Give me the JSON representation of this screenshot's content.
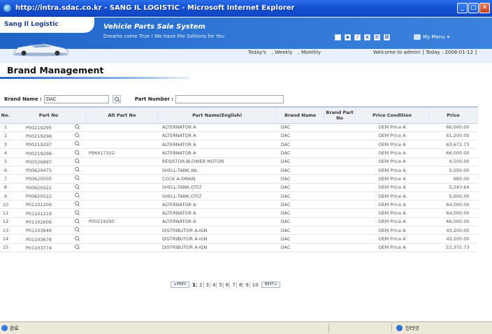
{
  "window": {
    "title": "http://intra.sdac.co.kr - SANG IL LOGISTIC - Microsoft Internet Explorer",
    "min": "_",
    "max": "□",
    "close": "✕"
  },
  "header": {
    "brand": "Sang Il Logistic",
    "system_title": "Vehicle Parts Sale System",
    "tagline": "Dreams come True ! We have the Soltions for You",
    "my_menu": "My Menu",
    "nav": [
      "Today's",
      ", Weekly",
      ", Monthly"
    ],
    "welcome": "Welcome to admin! [ Today : 2006-01-12 ]"
  },
  "page": {
    "title": "Brand Management"
  },
  "search": {
    "brand_label": "Brand Name :",
    "brand_value": "DAC",
    "part_label": "Part Number :",
    "part_value": ""
  },
  "table": {
    "headers": [
      "No.",
      "Part No",
      "Alt Part No",
      "Part Name(English)",
      "Brand Name",
      "Brand Part No",
      "Price Condition",
      "Price"
    ],
    "rows": [
      {
        "no": "1",
        "part": "P00219295",
        "alt": "",
        "name": "ALTERNATOR A",
        "brand": "DAC",
        "bpn": "",
        "cond": "OEM Price A",
        "price": "66,000.00"
      },
      {
        "no": "2",
        "part": "P00219296",
        "alt": "",
        "name": "ALTERNATOR A",
        "brand": "DAC",
        "bpn": "",
        "cond": "OEM Price A",
        "price": "61,200.00"
      },
      {
        "no": "3",
        "part": "P00219297",
        "alt": "",
        "name": "ALTERNATOR A",
        "brand": "DAC",
        "bpn": "",
        "cond": "OEM Price A",
        "price": "63,672.73"
      },
      {
        "no": "4",
        "part": "P00219298",
        "alt": "P96417322",
        "name": "ALTERNATOR A",
        "brand": "DAC",
        "bpn": "",
        "cond": "OEM Price A",
        "price": "66,000.00"
      },
      {
        "no": "5",
        "part": "P00526897",
        "alt": "",
        "name": "RESISTOR-BLOWER MOTOR",
        "brand": "DAC",
        "bpn": "",
        "cond": "OEM Price A",
        "price": "4,500.00"
      },
      {
        "no": "6",
        "part": "P00620475",
        "alt": "",
        "name": "SHELL-TANK,INL",
        "brand": "DAC",
        "bpn": "",
        "cond": "OEM Price A",
        "price": "5,050.00"
      },
      {
        "no": "7",
        "part": "P00620505",
        "alt": "",
        "name": "COCK A-DRAIN",
        "brand": "DAC",
        "bpn": "",
        "cond": "OEM Price A",
        "price": "680.00"
      },
      {
        "no": "8",
        "part": "P00620521",
        "alt": "",
        "name": "SHELL-TANK,OTLT",
        "brand": "DAC",
        "bpn": "",
        "cond": "OEM Price A",
        "price": "5,243.64"
      },
      {
        "no": "9",
        "part": "P00620522",
        "alt": "",
        "name": "SHELL-TANK,OTLT",
        "brand": "DAC",
        "bpn": "",
        "cond": "OEM Price A",
        "price": "5,600.00"
      },
      {
        "no": "10",
        "part": "P01101206",
        "alt": "",
        "name": "ALTERNATOR A",
        "brand": "DAC",
        "bpn": "",
        "cond": "OEM Price A",
        "price": "64,000.00"
      },
      {
        "no": "11",
        "part": "P01101219",
        "alt": "",
        "name": "ALTERNATOR A",
        "brand": "DAC",
        "bpn": "",
        "cond": "OEM Price A",
        "price": "64,000.00"
      },
      {
        "no": "12",
        "part": "P01102606",
        "alt": "P00219295",
        "name": "ALTERNATOR A",
        "brand": "DAC",
        "bpn": "",
        "cond": "OEM Price A",
        "price": "66,000.00"
      },
      {
        "no": "13",
        "part": "P01103649",
        "alt": "",
        "name": "DISTRIBUTOR A-IGN",
        "brand": "DAC",
        "bpn": "",
        "cond": "OEM Price A",
        "price": "43,200.00"
      },
      {
        "no": "14",
        "part": "P01103678",
        "alt": "",
        "name": "DISTRIBUTOR A-IGN",
        "brand": "DAC",
        "bpn": "",
        "cond": "OEM Price A",
        "price": "43,200.00"
      },
      {
        "no": "15",
        "part": "P01103774",
        "alt": "",
        "name": "DISTRIBUTOR A-IGN",
        "brand": "DAC",
        "bpn": "",
        "cond": "OEM Price A",
        "price": "53,372.73"
      }
    ]
  },
  "pager": {
    "prev": "◂ PREV",
    "next": "NEXT ▸",
    "pages": [
      "1",
      "2",
      "3",
      "4",
      "5",
      "6",
      "7",
      "8",
      "9",
      "10"
    ],
    "current": "1"
  },
  "status": {
    "left": "완료",
    "zone": "인터넷"
  }
}
